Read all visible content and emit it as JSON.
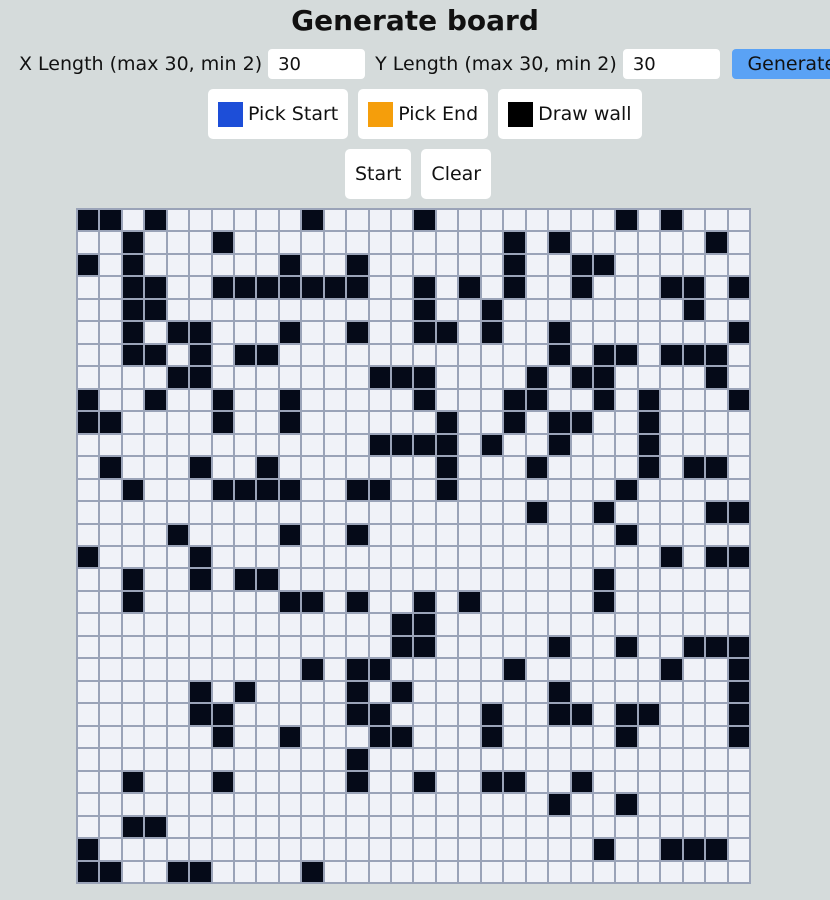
{
  "header": {
    "title": "Generate board"
  },
  "controls": {
    "x_label": "X Length (max 30, min 2)",
    "x_value": "30",
    "y_label": "Y Length (max 30, min 2)",
    "y_value": "30",
    "generate_label": "Generate"
  },
  "tools": {
    "pick_start": {
      "label": "Pick Start",
      "color": "#1d4ed8"
    },
    "pick_end": {
      "label": "Pick End",
      "color": "#f59e0b"
    },
    "draw_wall": {
      "label": "Draw wall",
      "color": "#000000"
    }
  },
  "actions": {
    "start_label": "Start",
    "clear_label": "Clear"
  },
  "board": {
    "cols": 30,
    "rows_count": 30,
    "colors": {
      "empty": "#f0f2f8",
      "wall": "#050a18",
      "grid": "#9aa3b8"
    },
    "rows": [
      "110100000010000100000000101000",
      "001000100000000000010100000010",
      "101000000100100000010011000000",
      "001100111111100101010010001101",
      "001100000000000100100000000100",
      "001011000100100110100100000001",
      "001101011000000000000101101110",
      "000011000000011100001011000010",
      "100100100100000100011001010001",
      "110000100100000010010110010000",
      "000000000000011110100100010000",
      "010001001000000010001000010110",
      "001000111100110010000000100000",
      "000000000000000000001001000011",
      "000010000100100000000000100000",
      "100001000000000000000000001011",
      "001001011000000000000001000000",
      "001000000110100101000001000000",
      "000000000000001100000000000000",
      "000000000000001100000100100111",
      "000000000010110000010000001001",
      "000001010000101000000100000001",
      "000001100000110000100110110001",
      "000000100100011000100000100001",
      "000000000000100000000000000000",
      "001000100000100100110010000000",
      "000000000000000000000100100000",
      "001100000000000000000000000000",
      "100000000000000000000001001110",
      "110011000010000000000000000000"
    ]
  }
}
